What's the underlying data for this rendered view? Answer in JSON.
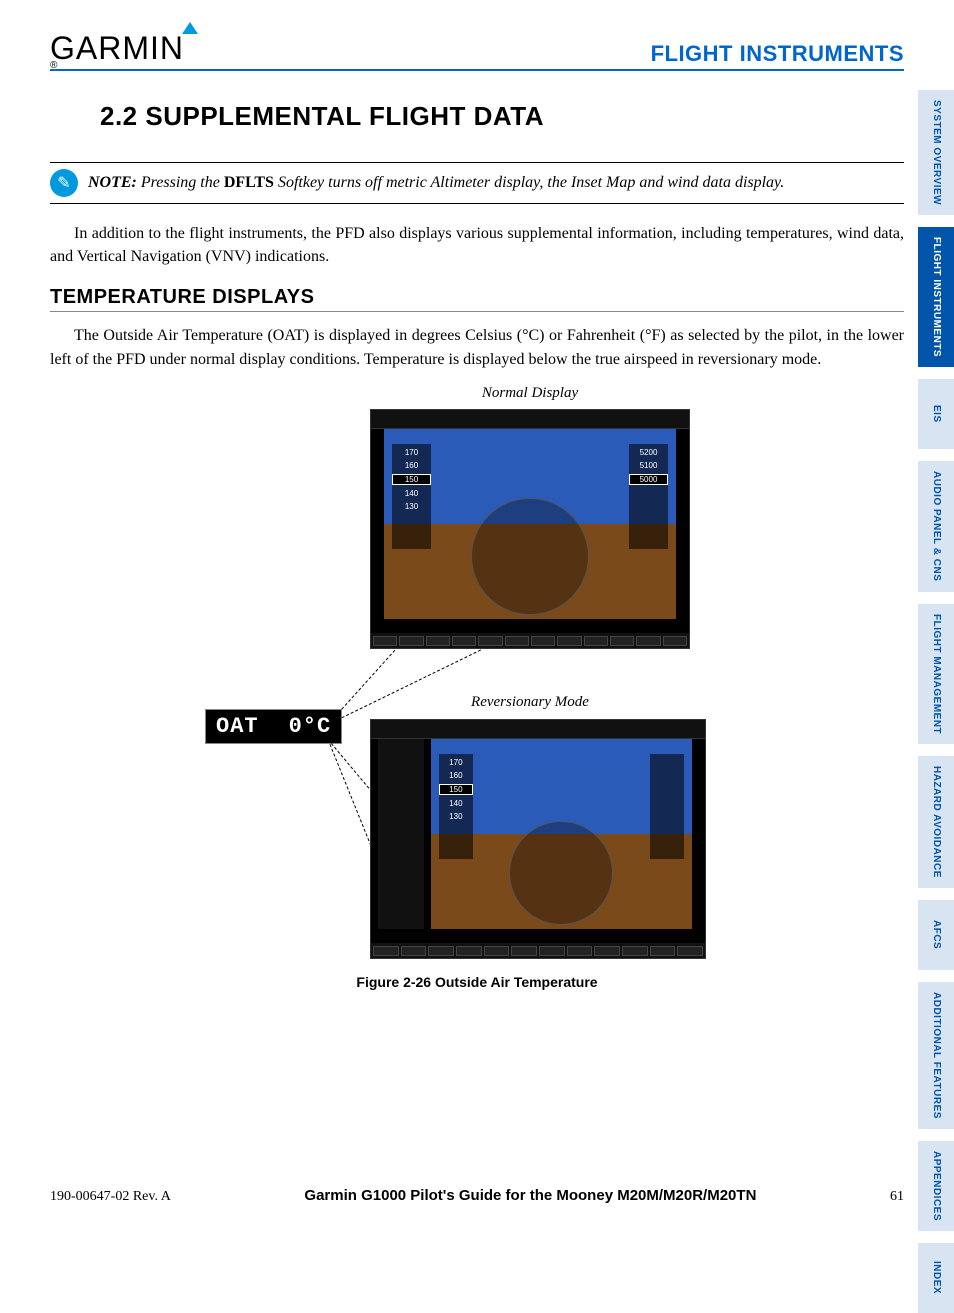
{
  "header": {
    "logo_text": "GARMIN",
    "section_header": "FLIGHT INSTRUMENTS"
  },
  "section": {
    "number_title": "2.2 SUPPLEMENTAL FLIGHT DATA"
  },
  "note": {
    "label": "NOTE:",
    "text_before": " Pressing the ",
    "dflts": "DFLTS",
    "text_after": " Softkey turns off metric Altimeter display, the Inset Map and wind data display."
  },
  "intro_para": "In addition to the flight instruments, the PFD also displays various supplemental information, including temperatures, wind data, and Vertical Navigation (VNV) indications.",
  "subhead": "TEMPERATURE DISPLAYS",
  "temp_para": "The Outside Air Temperature (OAT) is displayed in degrees Celsius (°C) or Fahrenheit (°F) as selected by the pilot, in the lower left of the PFD under normal display conditions.  Temperature is displayed below the true airspeed in reversionary mode.",
  "figure": {
    "label_top": "Normal Display",
    "label_bottom": "Reversionary Mode",
    "oat_label": "OAT",
    "oat_value": "0°C",
    "caption": "Figure 2-26  Outside Air Temperature",
    "tape_values": [
      "170",
      "160",
      "150",
      "140",
      "130"
    ],
    "alt_values": [
      "5200",
      "5100",
      "5000"
    ]
  },
  "footer": {
    "left": "190-00647-02  Rev. A",
    "center": "Garmin G1000 Pilot's Guide for the Mooney M20M/M20R/M20TN",
    "page": "61"
  },
  "tabs": [
    {
      "label": "SYSTEM OVERVIEW",
      "active": false
    },
    {
      "label": "FLIGHT INSTRUMENTS",
      "active": true
    },
    {
      "label": "EIS",
      "active": false
    },
    {
      "label": "AUDIO PANEL & CNS",
      "active": false
    },
    {
      "label": "FLIGHT MANAGEMENT",
      "active": false
    },
    {
      "label": "HAZARD AVOIDANCE",
      "active": false
    },
    {
      "label": "AFCS",
      "active": false
    },
    {
      "label": "ADDITIONAL FEATURES",
      "active": false
    },
    {
      "label": "APPENDICES",
      "active": false
    },
    {
      "label": "INDEX",
      "active": false
    }
  ]
}
